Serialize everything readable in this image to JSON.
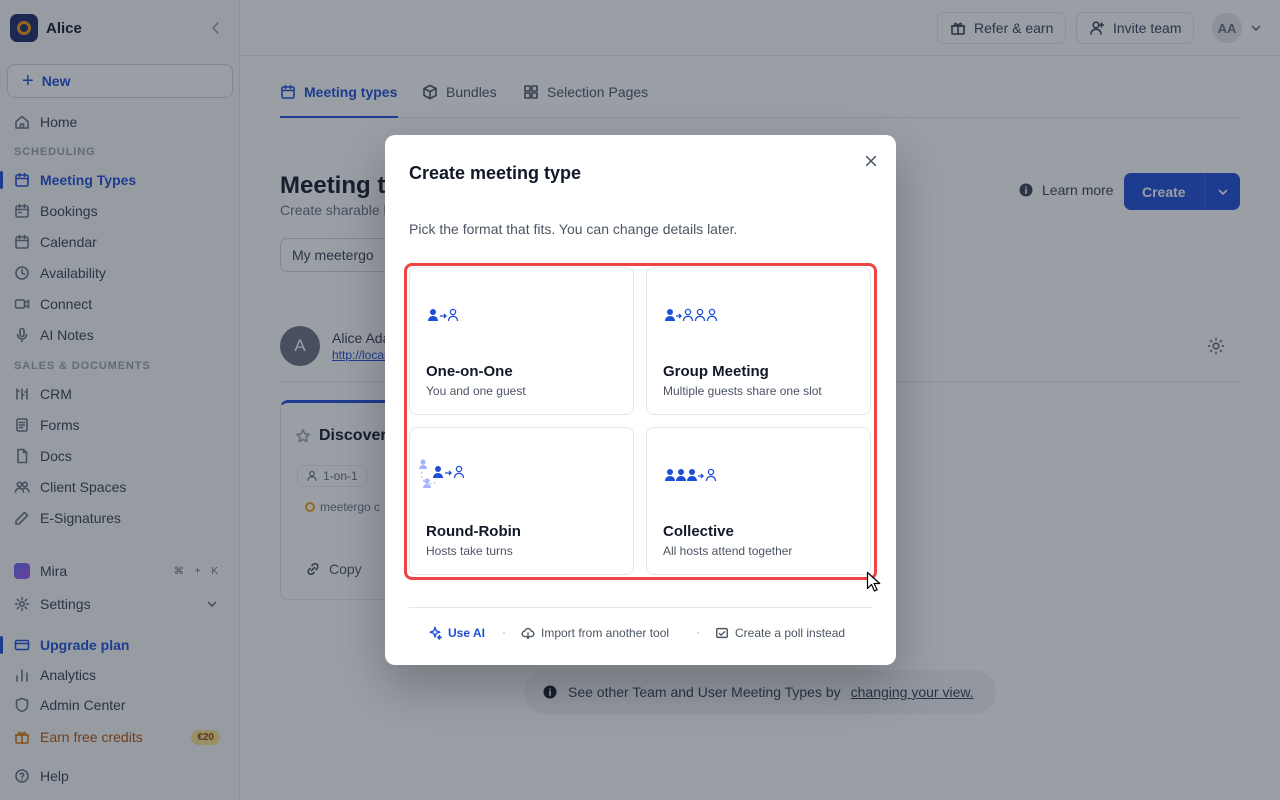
{
  "workspace": {
    "name": "Alice"
  },
  "sidebar": {
    "new_label": "New",
    "home": "Home",
    "section_scheduling": "SCHEDULING",
    "scheduling_items": [
      "Meeting Types",
      "Bookings",
      "Calendar",
      "Availability",
      "Connect",
      "AI Notes"
    ],
    "section_sales": "SALES & DOCUMENTS",
    "sales_items": [
      "CRM",
      "Forms",
      "Docs",
      "Client Spaces",
      "E-Signatures"
    ],
    "mira": "Mira",
    "mira_shortcut": "⌘ + K",
    "settings": "Settings",
    "upgrade": "Upgrade plan",
    "analytics": "Analytics",
    "admin": "Admin Center",
    "earn": "Earn free credits",
    "earn_badge": "€20",
    "help": "Help"
  },
  "header": {
    "refer": "Refer & earn",
    "invite": "Invite team",
    "avatar_initials": "AA"
  },
  "main": {
    "tabs": [
      "Meeting types",
      "Bundles",
      "Selection Pages"
    ],
    "title": "Meeting types",
    "subtitle": "Create sharable links",
    "learn_more": "Learn more",
    "create": "Create",
    "workspace_select": "My meetergo",
    "user": {
      "initial": "A",
      "name": "Alice Adams",
      "link": "http://localhost"
    },
    "event_card": {
      "title": "Discovery",
      "pill": "1-on-1",
      "org": "meetergo c",
      "copy": "Copy"
    },
    "banner_text": "See other Team and User Meeting Types by",
    "banner_link": "changing your view."
  },
  "modal": {
    "title": "Create meeting type",
    "subtitle": "Pick the format that fits. You can change details later.",
    "options": [
      {
        "name": "One-on-One",
        "desc": "You and one guest",
        "icon": "one-to-one-icon"
      },
      {
        "name": "Group Meeting",
        "desc": "Multiple guests share one slot",
        "icon": "group-icon"
      },
      {
        "name": "Round-Robin",
        "desc": "Hosts take turns",
        "icon": "round-robin-icon"
      },
      {
        "name": "Collective",
        "desc": "All hosts attend together",
        "icon": "collective-icon"
      }
    ],
    "footer": {
      "ai": "Use AI",
      "import": "Import from another tool",
      "poll": "Create a poll instead",
      "sep": "·"
    }
  },
  "colors": {
    "accent": "#1d4ed8",
    "highlight": "#ef4444",
    "warning": "#f59e0b"
  }
}
